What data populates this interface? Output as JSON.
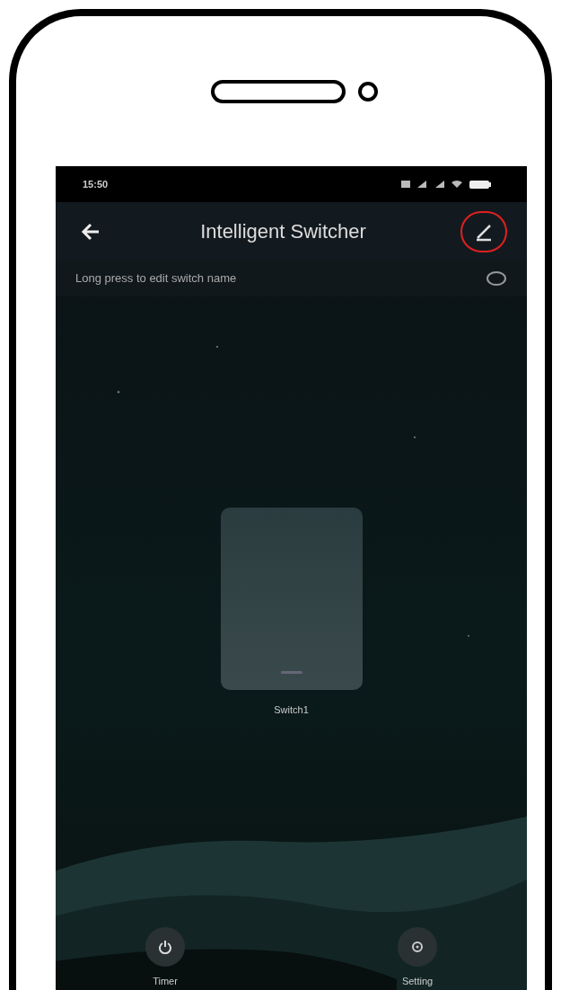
{
  "status_bar": {
    "time": "15:50"
  },
  "header": {
    "title": "Intelligent Switcher",
    "edit_highlighted": true
  },
  "notice": {
    "text": "Long press to edit switch name"
  },
  "switches": [
    {
      "name": "Switch1",
      "on": false
    }
  ],
  "bottom_buttons": [
    {
      "kind": "timer",
      "label": "Timer"
    },
    {
      "kind": "setting",
      "label": "Setting"
    }
  ]
}
